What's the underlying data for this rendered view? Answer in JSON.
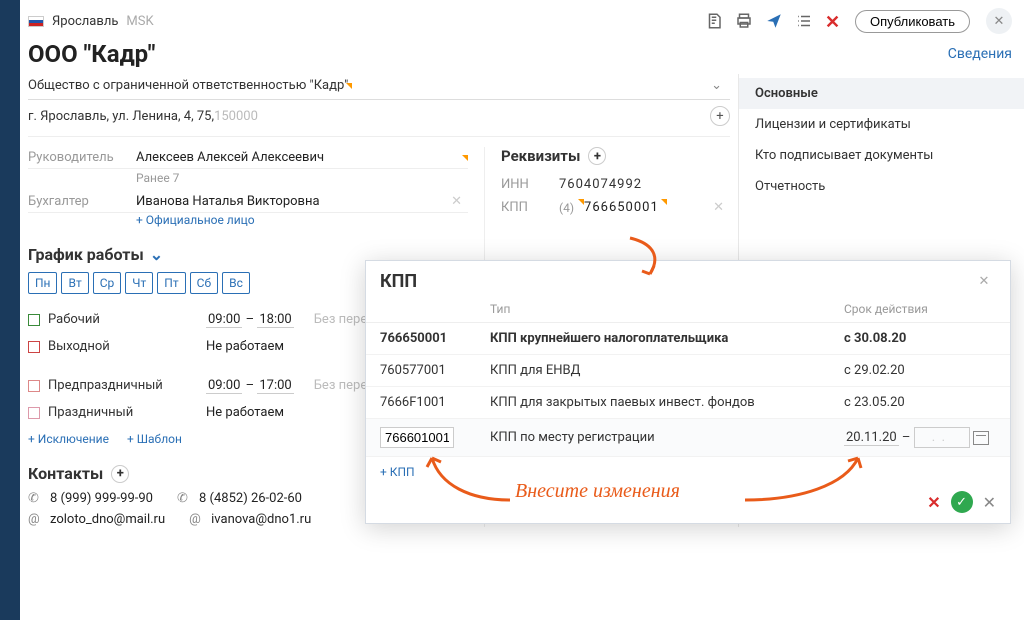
{
  "header": {
    "city": "Ярославль",
    "tz": "MSK",
    "publish": "Опубликовать",
    "details_link": "Сведения"
  },
  "company": {
    "title": "ООО \"Кадр\"",
    "full_name": "Общество с ограниченной ответственностью \"Кадр\"",
    "address_main": "г. Ярославль, ул. Ленина, 4, 75, ",
    "address_zip": "150000"
  },
  "people": {
    "head_label": "Руководитель",
    "head_name": "Алексеев Алексей Алексеевич",
    "head_prev": "Ранее 7",
    "accountant_label": "Бухгалтер",
    "accountant_name": "Иванова Наталья Викторовна",
    "add_official": "+ Официальное лицо"
  },
  "requisites": {
    "heading": "Реквизиты",
    "inn_label": "ИНН",
    "inn_value": "7604074992",
    "kpp_label": "КПП",
    "kpp_count": "(4)",
    "kpp_value": "766650001"
  },
  "right_nav": {
    "main": "Основные",
    "licenses": "Лицензии и сертификаты",
    "signers": "Кто подписывает документы",
    "reports": "Отчетность"
  },
  "schedule": {
    "heading": "График работы",
    "days": [
      "Пн",
      "Вт",
      "Ср",
      "Чт",
      "Пт",
      "Сб",
      "Вс"
    ],
    "work_label": "Рабочий",
    "work_from": "09:00",
    "work_to": "18:00",
    "off_label": "Выходной",
    "not_working": "Не работаем",
    "pre_label": "Предпраздничный",
    "pre_from": "09:00",
    "pre_to": "17:00",
    "holiday_label": "Праздничный",
    "no_break": "Без перерыва",
    "add_exception": "+ Исключение",
    "add_template": "+ Шаблон"
  },
  "contacts": {
    "heading": "Контакты",
    "phone1": "8 (999) 999-99-90",
    "phone2": "8 (4852) 26-02-60",
    "email1": "zoloto_dno@mail.ru",
    "email2": "ivanova@dno1.ru"
  },
  "kpp_panel": {
    "title": "КПП",
    "col_type": "Тип",
    "col_valid": "Срок действия",
    "add": "+ КПП",
    "rows": [
      {
        "code": "766650001",
        "type": "КПП крупнейшего налогоплательщика",
        "from": "с 30.08.20",
        "bold": true
      },
      {
        "code": "760577001",
        "type": "КПП для ЕНВД",
        "from": "с 29.02.20"
      },
      {
        "code": "7666F1001",
        "type": "КПП для закрытых паевых инвест. фондов",
        "from": "с 23.05.20"
      },
      {
        "code": "766601001",
        "type": "КПП по месту регистрации",
        "from": "20.11.20",
        "editing": true
      }
    ]
  },
  "annotation": {
    "text": "Внесите изменения"
  }
}
